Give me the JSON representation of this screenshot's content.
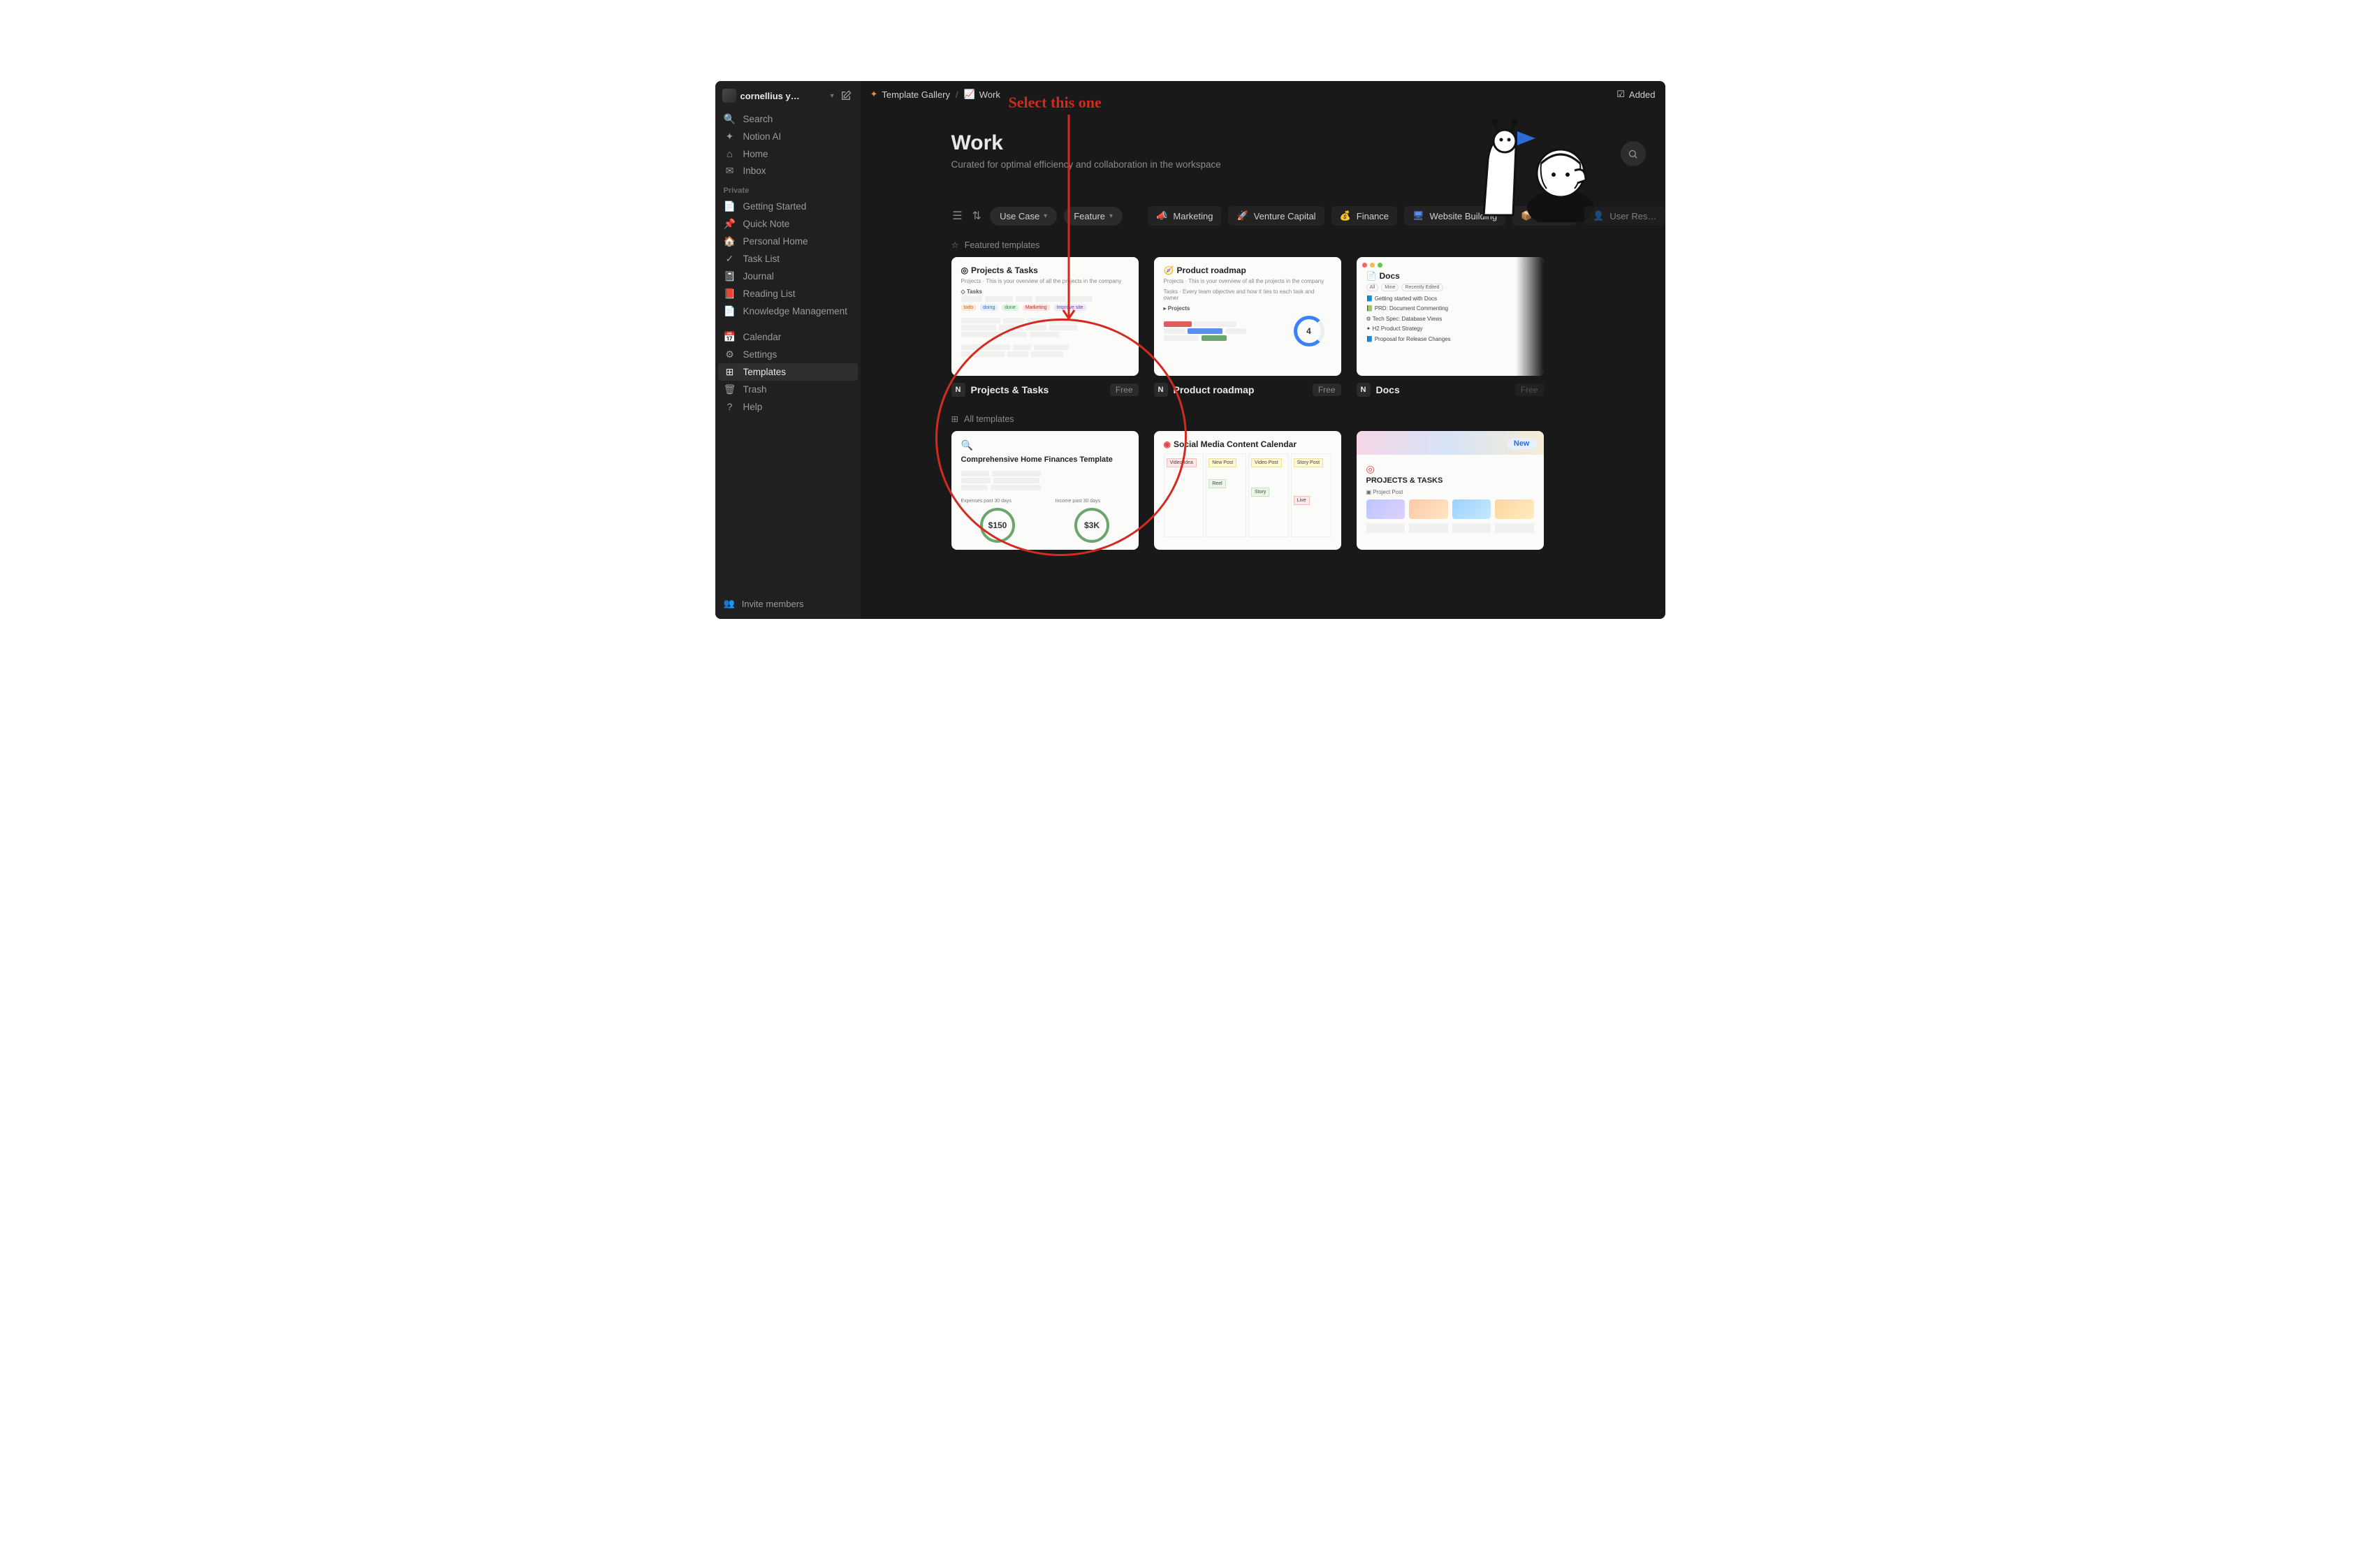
{
  "annotation": {
    "text": "Select this one"
  },
  "workspace": {
    "name": "cornellius y…"
  },
  "sidebar": {
    "top": [
      {
        "icon": "🔍",
        "label": "Search",
        "name": "search"
      },
      {
        "icon": "✦",
        "label": "Notion AI",
        "name": "notion-ai"
      },
      {
        "icon": "⌂",
        "label": "Home",
        "name": "home"
      },
      {
        "icon": "✉",
        "label": "Inbox",
        "name": "inbox"
      }
    ],
    "private_label": "Private",
    "private": [
      {
        "icon": "📄",
        "label": "Getting Started",
        "name": "getting-started"
      },
      {
        "icon": "📌",
        "label": "Quick Note",
        "name": "quick-note"
      },
      {
        "icon": "🏠",
        "label": "Personal Home",
        "name": "personal-home"
      },
      {
        "icon": "✓",
        "label": "Task List",
        "name": "task-list"
      },
      {
        "icon": "📓",
        "label": "Journal",
        "name": "journal"
      },
      {
        "icon": "📕",
        "label": "Reading List",
        "name": "reading-list"
      },
      {
        "icon": "📄",
        "label": "Knowledge Management",
        "name": "knowledge-management"
      }
    ],
    "bottom": [
      {
        "icon": "📅",
        "label": "Calendar",
        "name": "calendar"
      },
      {
        "icon": "⚙",
        "label": "Settings",
        "name": "settings"
      },
      {
        "icon": "⊞",
        "label": "Templates",
        "name": "templates",
        "active": true
      },
      {
        "icon": "🗑",
        "label": "Trash",
        "name": "trash"
      },
      {
        "icon": "?",
        "label": "Help",
        "name": "help"
      }
    ],
    "invite": {
      "icon": "👥",
      "label": "Invite members"
    }
  },
  "breadcrumb": {
    "gallery_icon": "✦",
    "gallery": "Template Gallery",
    "page_icon": "📈",
    "page": "Work"
  },
  "added_btn": "Added",
  "hero": {
    "title": "Work",
    "subtitle": "Curated for optimal efficiency and collaboration in the workspace"
  },
  "filters": {
    "use_case": "Use Case",
    "feature": "Feature",
    "categories": [
      {
        "icon": "📣",
        "label": "Marketing",
        "color": "#e05d5d"
      },
      {
        "icon": "🚀",
        "label": "Venture Capital",
        "color": "#5b8def"
      },
      {
        "icon": "💰",
        "label": "Finance",
        "color": "#6aa66e"
      },
      {
        "icon": "🖥",
        "label": "Website Building",
        "color": "#5b8def"
      },
      {
        "icon": "📦",
        "label": "Product",
        "color": "#5b8def"
      },
      {
        "icon": "👤",
        "label": "User Res…",
        "color": "#8a8a87",
        "fade": true
      }
    ]
  },
  "featured": {
    "heading": "Featured templates",
    "cards": [
      {
        "title": "Projects & Tasks",
        "badge": "Free"
      },
      {
        "title": "Product roadmap",
        "badge": "Free"
      },
      {
        "title": "Docs",
        "badge": "Free"
      }
    ]
  },
  "all": {
    "heading": "All templates",
    "cards": [
      {
        "title": "Comprehensive Home Finances Template"
      },
      {
        "title": "Social Media Content Calendar"
      },
      {
        "title": "PROJECTS & TASKS",
        "new_badge": "New"
      }
    ]
  },
  "thumb": {
    "projects_tasks": {
      "title": "Projects & Tasks",
      "tasks_head": "Tasks",
      "tags": [
        "todo",
        "doing",
        "done",
        "Marketing",
        "Improve site"
      ]
    },
    "product_roadmap": {
      "title": "Product roadmap",
      "projects_head": "Projects",
      "metric": "4"
    },
    "docs": {
      "title": "Docs",
      "pill_all": "All",
      "pill_mine": "Mine",
      "pill_recent": "Recently Edited",
      "rows": [
        "Getting started with Docs",
        "PRD: Document Commenting",
        "Tech Spec: Database Views",
        "H2 Product Strategy",
        "Proposal for Release Changes"
      ]
    },
    "finances": {
      "title": "Comprehensive Home Finances Template",
      "exp_label": "Expenses past 30 days",
      "inc_label": "Income past 30 days",
      "exp": "$150",
      "inc": "$3K"
    },
    "social": {
      "title": "Social Media Content Calendar"
    },
    "projects2": {
      "title": "PROJECTS & TASKS",
      "subtitle": "Project Post"
    }
  }
}
